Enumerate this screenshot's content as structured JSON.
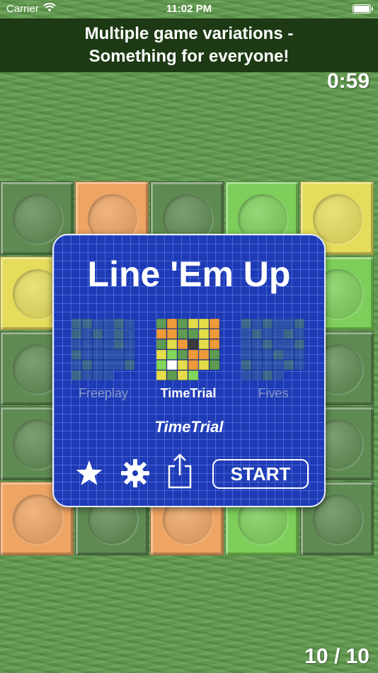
{
  "status_bar": {
    "carrier": "Carrier",
    "time": "11:02 PM"
  },
  "banner": {
    "line1": "Multiple game variations -",
    "line2": "Something for everyone!"
  },
  "timer": "0:59",
  "counter": "10 / 10",
  "colors": {
    "green_dark": "#5f8a52",
    "orange": "#eea463",
    "light_green": "#7dce5a",
    "yellow": "#e5dc5c",
    "dialog_blue": "#1e3bb5"
  },
  "board_rows": [
    [
      "green_dark",
      "orange",
      "green_dark",
      "light_green",
      "yellow"
    ],
    [
      "yellow",
      "orange",
      "green_dark",
      "light_green",
      "light_green"
    ],
    [
      "green_dark",
      "green_dark",
      "orange",
      "light_green",
      "green_dark"
    ],
    [
      "green_dark",
      "orange",
      "green_dark",
      "light_green",
      "green_dark"
    ],
    [
      "orange",
      "green_dark",
      "orange",
      "light_green",
      "green_dark"
    ]
  ],
  "dialog": {
    "title": "Line 'Em Up",
    "modes": [
      {
        "label": "Freeplay",
        "active": false
      },
      {
        "label": "TimeTrial",
        "active": true
      },
      {
        "label": "Fives",
        "active": false
      }
    ],
    "selected_mode": "TimeTrial",
    "start_label": "START",
    "icons": [
      "star-icon",
      "gear-icon",
      "share-icon"
    ]
  },
  "thumbnails": {
    "freeplay": [
      "ggbbgb",
      "gbgbgb",
      "bbbbgb",
      "gbbbbb",
      "bgbbbg",
      "gbbb__"
    ],
    "timetrial": [
      "gogyyo",
      "ooggyo",
      "gyoKyo",
      "ylgoog",
      "lwyoyg",
      "ygyl__"
    ],
    "fives": [
      "gbgbbg",
      "bgbbgb",
      "bbgbbg",
      "bbbgbb",
      "gbbbgb",
      "bbgb__"
    ]
  }
}
